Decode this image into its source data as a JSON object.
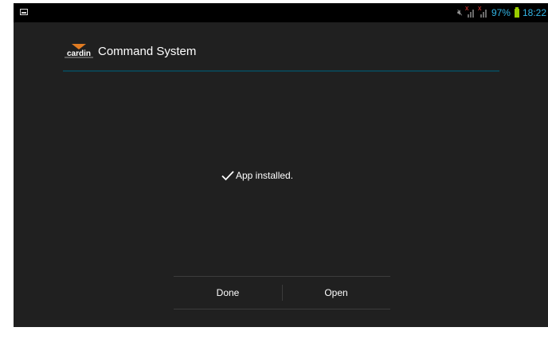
{
  "status_bar": {
    "battery": "97%",
    "time": "18:22",
    "icons": [
      "image-notification-icon",
      "mute-icon",
      "no-signal-icon",
      "battery-icon"
    ],
    "accent_color": "#33b5e5"
  },
  "action_bar": {
    "logo_text": "cardin",
    "title": "Command System"
  },
  "main": {
    "message": "App installed."
  },
  "buttons": {
    "done_label": "Done",
    "open_label": "Open"
  }
}
